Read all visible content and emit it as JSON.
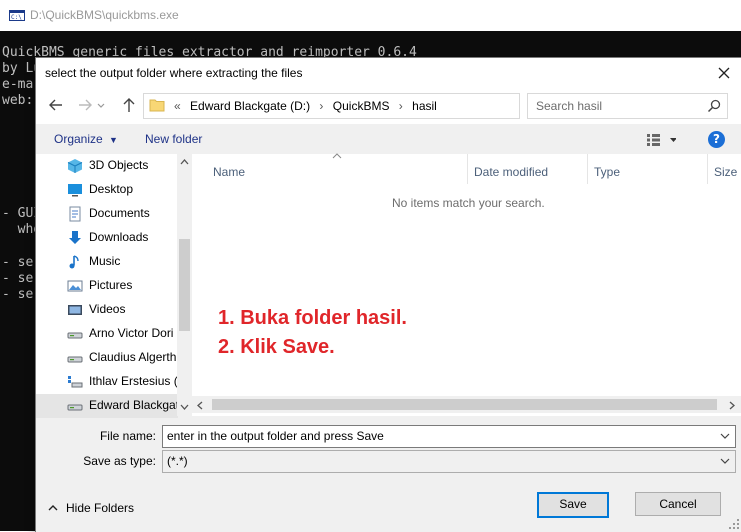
{
  "console": {
    "title": "D:\\QuickBMS\\quickbms.exe",
    "lines": {
      "l1": "QuickBMS generic files extractor and reimporter 0.6.4",
      "l2": "by Lu",
      "l3": "e-ma",
      "l4": "web:",
      "l5": "- GUI",
      "l6": "  whe",
      "l7": "- se",
      "l8": "- se",
      "l9": "- se"
    }
  },
  "dialog": {
    "title": "select the output folder where extracting the files",
    "breadcrumb": {
      "prefix": "«",
      "items": [
        "Edward Blackgate (D:)",
        "QuickBMS",
        "hasil"
      ]
    },
    "search_placeholder": "Search hasil",
    "toolbar": {
      "organize": "Organize",
      "new_folder": "New folder",
      "help": "?"
    },
    "nav_items": [
      {
        "label": "3D Objects",
        "icon": "3d-objects-icon"
      },
      {
        "label": "Desktop",
        "icon": "desktop-icon"
      },
      {
        "label": "Documents",
        "icon": "documents-icon"
      },
      {
        "label": "Downloads",
        "icon": "downloads-icon"
      },
      {
        "label": "Music",
        "icon": "music-icon"
      },
      {
        "label": "Pictures",
        "icon": "pictures-icon"
      },
      {
        "label": "Videos",
        "icon": "videos-icon"
      },
      {
        "label": "Arno Victor Dori",
        "icon": "drive-icon"
      },
      {
        "label": "Claudius Algerth",
        "icon": "drive-icon"
      },
      {
        "label": "Ithlav Erstesius (",
        "icon": "network-drive-icon"
      },
      {
        "label": "Edward Blackgate",
        "icon": "drive-icon"
      }
    ],
    "columns": {
      "name": "Name",
      "date_modified": "Date modified",
      "type": "Type",
      "size": "Size"
    },
    "empty_message": "No items match your search.",
    "annotations": {
      "step1": "1. Buka folder hasil.",
      "step2": "2. Klik Save."
    },
    "file_name_label": "File name:",
    "file_name_value": "enter in the output folder and press Save",
    "save_as_type_label": "Save as type:",
    "save_as_type_value": "(*.*)",
    "hide_folders": "Hide Folders",
    "save_button": "Save",
    "cancel_button": "Cancel"
  },
  "colors": {
    "annotation": "#e0262a",
    "link": "#1e3287",
    "primary_border": "#0078d7",
    "console_bg": "#0c0c0c"
  }
}
